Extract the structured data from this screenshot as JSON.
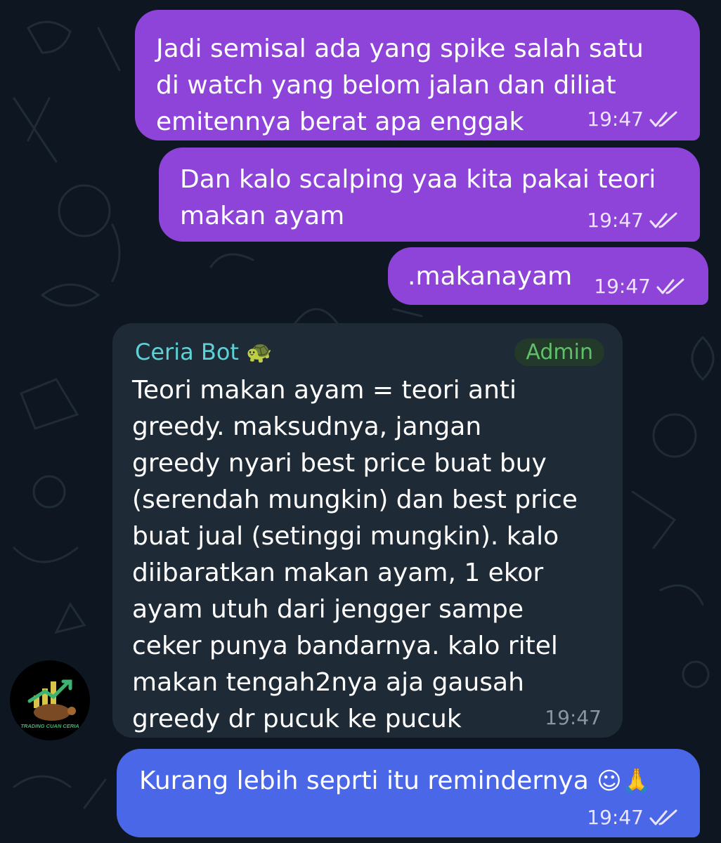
{
  "messages": [
    {
      "lines": [
        "Jadi semisal ada yang spike salah satu",
        "di watch yang belom jalan dan diliat",
        "emitennya berat apa enggak"
      ],
      "time": "19:47"
    },
    {
      "lines": [
        "Dan kalo scalping yaa kita pakai teori",
        "makan ayam"
      ],
      "time": "19:47"
    },
    {
      "lines": [
        ".makanayam"
      ],
      "time": "19:47"
    },
    {
      "sender": "Ceria Bot",
      "sender_emoji": "🐢",
      "badge": "Admin",
      "lines": [
        "Teori makan ayam = teori anti",
        "greedy. maksudnya, jangan",
        "greedy nyari best price buat buy",
        "(serendah mungkin) dan best price",
        "buat jual (setinggi mungkin). kalo",
        "diibaratkan makan ayam, 1 ekor",
        "ayam utuh dari jengger sampe",
        "ceker punya bandarnya. kalo ritel",
        "makan tengah2nya aja gausah",
        "greedy dr pucuk ke pucuk"
      ],
      "time": "19:47"
    },
    {
      "text": "Kurang lebih seprti itu remindernya",
      "emoji": "☺🙏",
      "time": "19:47"
    }
  ],
  "avatar": {
    "brand_text": "TRADING CUAN CERIA"
  },
  "colors": {
    "background": "#0e1621",
    "outgoing_purple": "#8e44d8",
    "outgoing_blue": "#4a67e8",
    "incoming": "#1e2a36",
    "sender_name": "#5fd0d6",
    "admin_badge": "#5fbf6a"
  }
}
